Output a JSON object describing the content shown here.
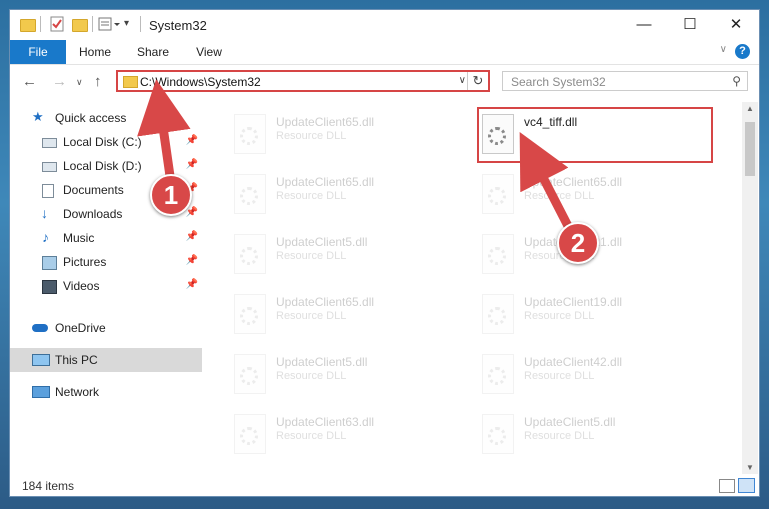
{
  "window": {
    "title": "System32",
    "controls": {
      "minimize": "—",
      "maximize": "☐",
      "close": "✕"
    }
  },
  "ribbon": {
    "tabs": [
      "File",
      "Home",
      "Share",
      "View"
    ],
    "help": "?"
  },
  "navbar": {
    "address": "C:\\Windows\\System32",
    "search_placeholder": "Search System32"
  },
  "sidebar": {
    "quick_access": "Quick access",
    "items": [
      {
        "label": "Local Disk (C:)",
        "icon": "drive-icon",
        "pinned": true
      },
      {
        "label": "Local Disk (D:)",
        "icon": "drive-icon",
        "pinned": true
      },
      {
        "label": "Documents",
        "icon": "documents-icon",
        "pinned": true
      },
      {
        "label": "Downloads",
        "icon": "downloads-icon",
        "pinned": true
      },
      {
        "label": "Music",
        "icon": "music-icon",
        "pinned": true
      },
      {
        "label": "Pictures",
        "icon": "pictures-icon",
        "pinned": true
      },
      {
        "label": "Videos",
        "icon": "videos-icon",
        "pinned": true
      }
    ],
    "onedrive": "OneDrive",
    "this_pc": "This PC",
    "network": "Network"
  },
  "files": {
    "left_column": [
      {
        "name": "UpdateClient65.dll",
        "type": "Resource DLL"
      },
      {
        "name": "UpdateClient65.dll",
        "type": "Resource DLL"
      },
      {
        "name": "UpdateClient5.dll",
        "type": "Resource DLL"
      },
      {
        "name": "UpdateClient65.dll",
        "type": "Resource DLL"
      },
      {
        "name": "UpdateClient5.dll",
        "type": "Resource DLL"
      },
      {
        "name": "UpdateClient63.dll",
        "type": "Resource DLL"
      }
    ],
    "highlighted": {
      "name": "vc4_tiff.dll"
    },
    "right_column": [
      {
        "name": "UpdateClient65.dll",
        "type": "Resource DLL"
      },
      {
        "name": "UpdateClient21.dll",
        "type": "Resource DLL"
      },
      {
        "name": "UpdateClient19.dll",
        "type": "Resource DLL"
      },
      {
        "name": "UpdateClient42.dll",
        "type": "Resource DLL"
      },
      {
        "name": "UpdateClient5.dll",
        "type": "Resource DLL"
      }
    ]
  },
  "status": {
    "item_count": "184 items"
  },
  "annotations": {
    "step1": "1",
    "step2": "2",
    "color": "#d84848"
  }
}
